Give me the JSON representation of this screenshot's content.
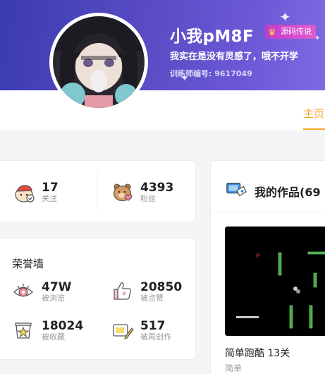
{
  "profile": {
    "name": "小我pM8F",
    "badge": "源码传说",
    "bio": "我实在是没有灵感了，哦不开学",
    "trainer_id": "训练师编号: 9617049"
  },
  "nav": {
    "tabs": [
      {
        "label": "主页"
      }
    ],
    "active_color": "#f5a623"
  },
  "follow_stats": {
    "following": {
      "value": "17",
      "label": "关注"
    },
    "fans": {
      "value": "4393",
      "label": "粉丝"
    }
  },
  "honor_wall": {
    "title": "荣誉墙",
    "items": [
      {
        "value": "47W",
        "label": "被浏览",
        "icon": "eye-icon"
      },
      {
        "value": "20850",
        "label": "被点赞",
        "icon": "thumbs-up-icon"
      },
      {
        "value": "18024",
        "label": "被收藏",
        "icon": "star-box-icon"
      },
      {
        "value": "517",
        "label": "被再创作",
        "icon": "pencil-icon"
      }
    ]
  },
  "works": {
    "title": "我的作品(69",
    "items": [
      {
        "title": "简单跑酷 13关",
        "subtitle": "简单"
      }
    ]
  },
  "colors": {
    "banner_start": "#3b3bb0",
    "banner_end": "#7e6ae2",
    "accent": "#f5a623",
    "badge": "#d14ac9"
  }
}
